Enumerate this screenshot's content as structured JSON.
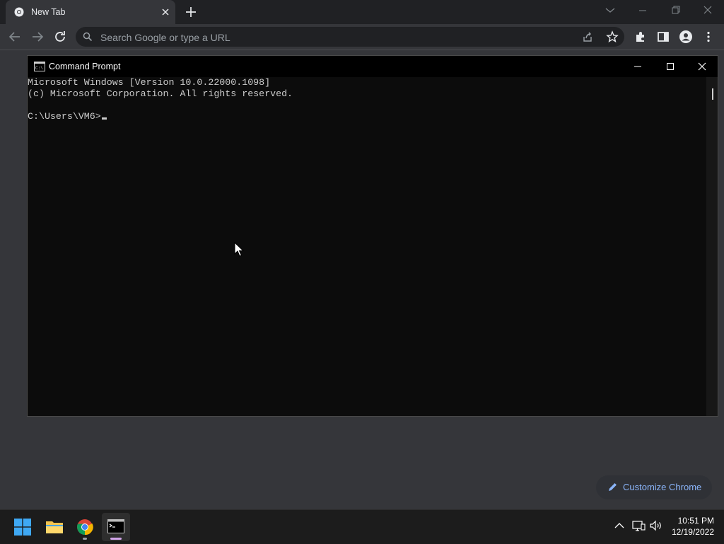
{
  "browser": {
    "tab": {
      "title": "New Tab"
    },
    "omnibox": {
      "placeholder": "Search Google or type a URL"
    },
    "customize_label": "Customize Chrome"
  },
  "cmd": {
    "title": "Command Prompt",
    "lines": [
      "Microsoft Windows [Version 10.0.22000.1098]",
      "(c) Microsoft Corporation. All rights reserved.",
      "",
      "C:\\Users\\VM6>"
    ]
  },
  "taskbar": {
    "apps": [
      "start-icon",
      "file-explorer-icon",
      "chrome-icon",
      "command-prompt-icon"
    ],
    "time": "10:51 PM",
    "date": "12/19/2022"
  },
  "colors": {
    "chrome_frame": "#202124",
    "chrome_toolbar": "#35363a",
    "link_blue": "#8ab4f8",
    "console_bg": "#0c0c0c",
    "console_text": "#cccccc",
    "taskbar_bg": "#1c1c1c"
  }
}
